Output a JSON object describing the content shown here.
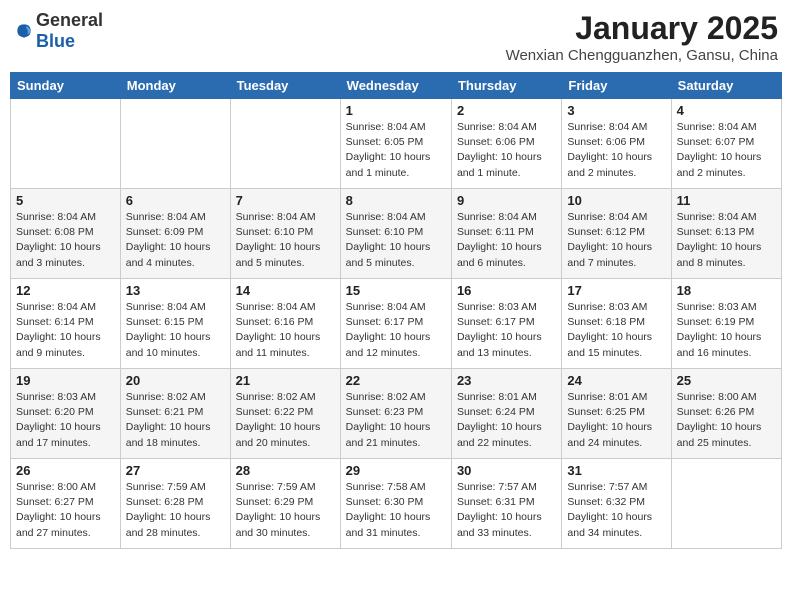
{
  "logo": {
    "general": "General",
    "blue": "Blue"
  },
  "title": "January 2025",
  "location": "Wenxian Chengguanzhen, Gansu, China",
  "weekdays": [
    "Sunday",
    "Monday",
    "Tuesday",
    "Wednesday",
    "Thursday",
    "Friday",
    "Saturday"
  ],
  "weeks": [
    [
      {
        "day": "",
        "info": ""
      },
      {
        "day": "",
        "info": ""
      },
      {
        "day": "",
        "info": ""
      },
      {
        "day": "1",
        "info": "Sunrise: 8:04 AM\nSunset: 6:05 PM\nDaylight: 10 hours\nand 1 minute."
      },
      {
        "day": "2",
        "info": "Sunrise: 8:04 AM\nSunset: 6:06 PM\nDaylight: 10 hours\nand 1 minute."
      },
      {
        "day": "3",
        "info": "Sunrise: 8:04 AM\nSunset: 6:06 PM\nDaylight: 10 hours\nand 2 minutes."
      },
      {
        "day": "4",
        "info": "Sunrise: 8:04 AM\nSunset: 6:07 PM\nDaylight: 10 hours\nand 2 minutes."
      }
    ],
    [
      {
        "day": "5",
        "info": "Sunrise: 8:04 AM\nSunset: 6:08 PM\nDaylight: 10 hours\nand 3 minutes."
      },
      {
        "day": "6",
        "info": "Sunrise: 8:04 AM\nSunset: 6:09 PM\nDaylight: 10 hours\nand 4 minutes."
      },
      {
        "day": "7",
        "info": "Sunrise: 8:04 AM\nSunset: 6:10 PM\nDaylight: 10 hours\nand 5 minutes."
      },
      {
        "day": "8",
        "info": "Sunrise: 8:04 AM\nSunset: 6:10 PM\nDaylight: 10 hours\nand 5 minutes."
      },
      {
        "day": "9",
        "info": "Sunrise: 8:04 AM\nSunset: 6:11 PM\nDaylight: 10 hours\nand 6 minutes."
      },
      {
        "day": "10",
        "info": "Sunrise: 8:04 AM\nSunset: 6:12 PM\nDaylight: 10 hours\nand 7 minutes."
      },
      {
        "day": "11",
        "info": "Sunrise: 8:04 AM\nSunset: 6:13 PM\nDaylight: 10 hours\nand 8 minutes."
      }
    ],
    [
      {
        "day": "12",
        "info": "Sunrise: 8:04 AM\nSunset: 6:14 PM\nDaylight: 10 hours\nand 9 minutes."
      },
      {
        "day": "13",
        "info": "Sunrise: 8:04 AM\nSunset: 6:15 PM\nDaylight: 10 hours\nand 10 minutes."
      },
      {
        "day": "14",
        "info": "Sunrise: 8:04 AM\nSunset: 6:16 PM\nDaylight: 10 hours\nand 11 minutes."
      },
      {
        "day": "15",
        "info": "Sunrise: 8:04 AM\nSunset: 6:17 PM\nDaylight: 10 hours\nand 12 minutes."
      },
      {
        "day": "16",
        "info": "Sunrise: 8:03 AM\nSunset: 6:17 PM\nDaylight: 10 hours\nand 13 minutes."
      },
      {
        "day": "17",
        "info": "Sunrise: 8:03 AM\nSunset: 6:18 PM\nDaylight: 10 hours\nand 15 minutes."
      },
      {
        "day": "18",
        "info": "Sunrise: 8:03 AM\nSunset: 6:19 PM\nDaylight: 10 hours\nand 16 minutes."
      }
    ],
    [
      {
        "day": "19",
        "info": "Sunrise: 8:03 AM\nSunset: 6:20 PM\nDaylight: 10 hours\nand 17 minutes."
      },
      {
        "day": "20",
        "info": "Sunrise: 8:02 AM\nSunset: 6:21 PM\nDaylight: 10 hours\nand 18 minutes."
      },
      {
        "day": "21",
        "info": "Sunrise: 8:02 AM\nSunset: 6:22 PM\nDaylight: 10 hours\nand 20 minutes."
      },
      {
        "day": "22",
        "info": "Sunrise: 8:02 AM\nSunset: 6:23 PM\nDaylight: 10 hours\nand 21 minutes."
      },
      {
        "day": "23",
        "info": "Sunrise: 8:01 AM\nSunset: 6:24 PM\nDaylight: 10 hours\nand 22 minutes."
      },
      {
        "day": "24",
        "info": "Sunrise: 8:01 AM\nSunset: 6:25 PM\nDaylight: 10 hours\nand 24 minutes."
      },
      {
        "day": "25",
        "info": "Sunrise: 8:00 AM\nSunset: 6:26 PM\nDaylight: 10 hours\nand 25 minutes."
      }
    ],
    [
      {
        "day": "26",
        "info": "Sunrise: 8:00 AM\nSunset: 6:27 PM\nDaylight: 10 hours\nand 27 minutes."
      },
      {
        "day": "27",
        "info": "Sunrise: 7:59 AM\nSunset: 6:28 PM\nDaylight: 10 hours\nand 28 minutes."
      },
      {
        "day": "28",
        "info": "Sunrise: 7:59 AM\nSunset: 6:29 PM\nDaylight: 10 hours\nand 30 minutes."
      },
      {
        "day": "29",
        "info": "Sunrise: 7:58 AM\nSunset: 6:30 PM\nDaylight: 10 hours\nand 31 minutes."
      },
      {
        "day": "30",
        "info": "Sunrise: 7:57 AM\nSunset: 6:31 PM\nDaylight: 10 hours\nand 33 minutes."
      },
      {
        "day": "31",
        "info": "Sunrise: 7:57 AM\nSunset: 6:32 PM\nDaylight: 10 hours\nand 34 minutes."
      },
      {
        "day": "",
        "info": ""
      }
    ]
  ]
}
